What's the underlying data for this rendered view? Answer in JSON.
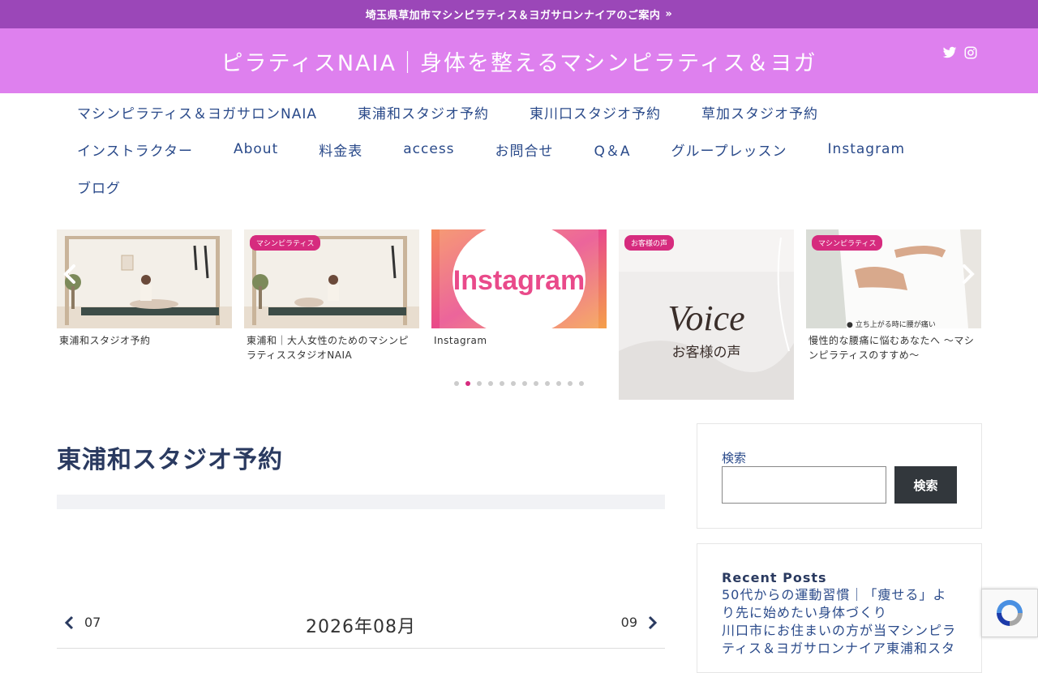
{
  "notice": {
    "text": "埼玉県草加市マシンピラティス＆ヨガサロンナイアのご案内",
    "chevron_icon": "double-chevron-right-icon"
  },
  "header": {
    "site_title": "ピラティスNAIA｜身体を整えるマシンピラティス＆ヨガ",
    "background": "#de80ee",
    "social": [
      "twitter-icon",
      "instagram-icon"
    ]
  },
  "nav": {
    "row1": [
      "マシンピラティス＆ヨガサロンNAIA",
      "東浦和スタジオ予約",
      "東川口スタジオ予約",
      "草加スタジオ予約"
    ],
    "row2": [
      "インストラクター",
      "About",
      "料金表",
      "access",
      "お問合せ",
      "Q＆A",
      "グループレッスン",
      "Instagram"
    ],
    "row3": [
      "ブログ"
    ]
  },
  "carousel": {
    "cards": [
      {
        "tag": "",
        "caption": "東浦和スタジオ予約"
      },
      {
        "tag": "マシンピラティス",
        "caption": "東浦和｜大人女性のためのマシンピラティススタジオNAIA"
      },
      {
        "tag": "",
        "caption": "Instagram",
        "image_text": "Instagram"
      },
      {
        "tag": "お客様の声",
        "caption": "",
        "image_text": "Voice",
        "image_subtext": "お客様の声"
      },
      {
        "tag": "マシンピラティス",
        "caption": "慢性的な腰痛に悩むあなたへ 〜マシンピラティスのすすめ〜",
        "image_text": "● 立ち上がる時に腰が痛い"
      }
    ],
    "active_dot": 1,
    "dot_count": 12
  },
  "main": {
    "page_title": "東浦和スタジオ予約",
    "calendar": {
      "prev": "07",
      "month": "2026年08月",
      "next": "09"
    }
  },
  "sidebar": {
    "search": {
      "label": "検索",
      "button": "検索",
      "placeholder": ""
    },
    "recent": {
      "heading": "Recent Posts",
      "items": [
        "50代からの運動習慣｜「痩せる」より先に始めたい身体づくり",
        "川口市にお住まいの方が当マシンピラティス＆ヨガサロンナイア東浦和スタ"
      ]
    }
  },
  "colors": {
    "notice_bg": "#9b47b8",
    "header_bg": "#de80ee",
    "nav_text": "#2a4a8a",
    "tag_bg": "#d62b7e"
  }
}
